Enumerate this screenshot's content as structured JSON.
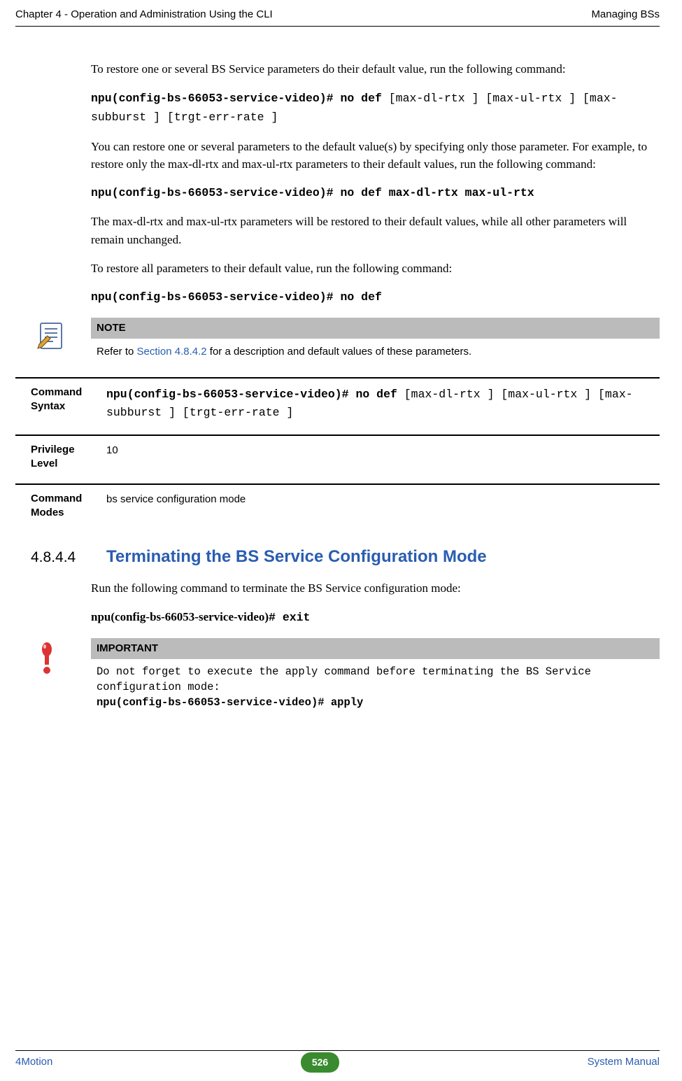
{
  "header": {
    "left": "Chapter 4 - Operation and Administration Using the CLI",
    "right": "Managing BSs"
  },
  "body": {
    "p1": "To restore one or several BS Service parameters do their default value, run the following command:",
    "cmd1a": "npu(config-bs-66053-service-video)# no def ",
    "cmd1b": "[max-dl-rtx ] [max-ul-rtx ] [max-subburst ] [trgt-err-rate ]",
    "p2": "You can restore one or several parameters to the default value(s) by specifying only those parameter. For example, to restore only the max-dl-rtx and max-ul-rtx parameters to their default values, run the following command:",
    "cmd2": "npu(config-bs-66053-service-video)# no def max-dl-rtx max-ul-rtx",
    "p3": "The max-dl-rtx and max-ul-rtx parameters will be restored to their default values, while all other parameters will remain unchanged.",
    "p4": "To restore all parameters to their default value, run the following command:",
    "cmd3": "npu(config-bs-66053-service-video)# no def"
  },
  "note": {
    "title": "NOTE",
    "text_before": "Refer to ",
    "link": "Section 4.8.4.2",
    "text_after": " for a description and default values of these parameters."
  },
  "defs": {
    "syntax_label": "Command Syntax",
    "syntax_cmd_a": "npu(config-bs-66053-service-video)# no def ",
    "syntax_cmd_b": "[max-dl-rtx ] [max-ul-rtx ] [max-subburst ] [trgt-err-rate ]",
    "privilege_label": "Privilege Level",
    "privilege_value": "10",
    "modes_label": "Command Modes",
    "modes_value": "bs service  configuration mode"
  },
  "section": {
    "num": "4.8.4.4",
    "title": "Terminating the BS Service Configuration Mode",
    "p1": "Run the following command to terminate the BS Service configuration mode:",
    "cmd_a": "npu(config-bs-66053-service-video)",
    "cmd_b": "# exit"
  },
  "important": {
    "title": "IMPORTANT",
    "text": "Do not forget to execute the apply command before terminating the BS Service configuration mode:",
    "cmd": "npu(config-bs-66053-service-video)# apply"
  },
  "footer": {
    "left": "4Motion",
    "page": "526",
    "right": "System Manual"
  }
}
